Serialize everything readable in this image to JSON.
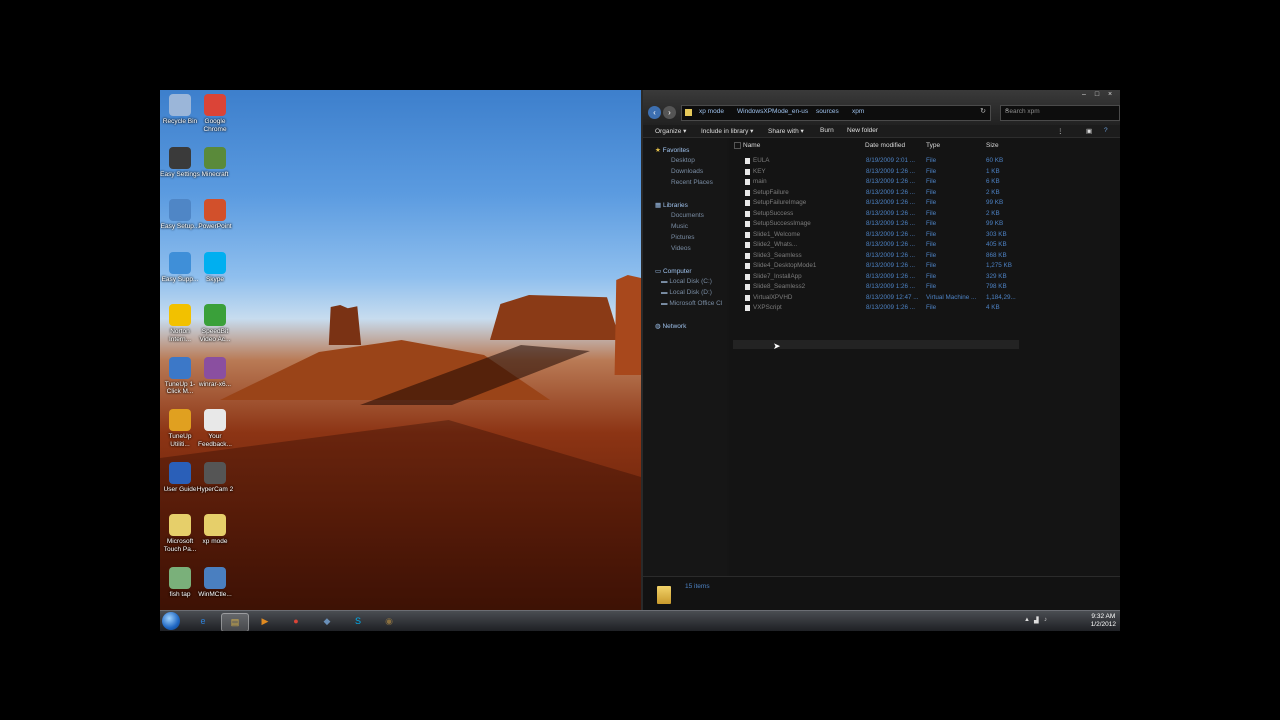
{
  "desktop_icons": [
    {
      "label": "Recycle Bin",
      "icon": "recycle-bin-icon",
      "color": "#9bb6d9"
    },
    {
      "label": "Google Chrome",
      "icon": "chrome-icon",
      "color": "#db4437"
    },
    {
      "label": "Easy Settings",
      "icon": "easy-settings-icon",
      "color": "#3a3a3a"
    },
    {
      "label": "Minecraft",
      "icon": "minecraft-icon",
      "color": "#5a8a3a"
    },
    {
      "label": "Easy Setup...",
      "icon": "easy-setup-icon",
      "color": "#4f86c6"
    },
    {
      "label": "PowerPoint",
      "icon": "powerpoint-icon",
      "color": "#d2502b"
    },
    {
      "label": "Easy Supp...",
      "icon": "easy-support-icon",
      "color": "#3f8fd8"
    },
    {
      "label": "Skype",
      "icon": "skype-icon",
      "color": "#00aff0"
    },
    {
      "label": "Norton Intern...",
      "icon": "norton-icon",
      "color": "#f2c100"
    },
    {
      "label": "SpeedBit Video Ac...",
      "icon": "speedbit-icon",
      "color": "#3aa03a"
    },
    {
      "label": "TuneUp 1-Click M...",
      "icon": "tuneup-icon",
      "color": "#3c78c8"
    },
    {
      "label": "winrar-x6...",
      "icon": "winrar-icon",
      "color": "#8a4fa0"
    },
    {
      "label": "TuneUp Utiliti...",
      "icon": "tuneup-utilities-icon",
      "color": "#e0a020"
    },
    {
      "label": "Your Feedback...",
      "icon": "feedback-icon",
      "color": "#e8e8e8"
    },
    {
      "label": "User Guide",
      "icon": "user-guide-icon",
      "color": "#2a5fb8"
    },
    {
      "label": "HyperCam 2",
      "icon": "hypercam-icon",
      "color": "#555555"
    },
    {
      "label": "Microsoft Touch Pa...",
      "icon": "touch-pack-icon",
      "color": "#e6cf6a"
    },
    {
      "label": "xp mode",
      "icon": "folder-icon",
      "color": "#e6cf6a"
    },
    {
      "label": "fish tap",
      "icon": "fish-tap-icon",
      "color": "#7ab07a"
    },
    {
      "label": "WinMCtle...",
      "icon": "winmctle-icon",
      "color": "#4a7fc0"
    }
  ],
  "explorer": {
    "window_controls": {
      "minimize": "–",
      "maximize": "□",
      "close": "×"
    },
    "breadcrumbs": [
      "xp mode",
      "WindowsXPMode_en-us",
      "sources",
      "xpm"
    ],
    "search_placeholder": "Search xpm",
    "toolbar": {
      "organize": "Organize ▾",
      "include": "Include in library ▾",
      "share": "Share with ▾",
      "burn": "Burn",
      "new_folder": "New folder"
    },
    "nav": {
      "favorites": "Favorites",
      "favorites_items": [
        "Desktop",
        "Downloads",
        "Recent Places"
      ],
      "libraries": "Libraries",
      "libraries_items": [
        "Documents",
        "Music",
        "Pictures",
        "Videos"
      ],
      "computer": "Computer",
      "computer_items": [
        "Local Disk (C:)",
        "Local Disk (D:)",
        "Microsoft Office Cl"
      ],
      "network": "Network"
    },
    "columns": [
      "Name",
      "Date modified",
      "Type",
      "Size"
    ],
    "files": [
      {
        "name": "EULA",
        "date": "8/19/2009 2:01 ...",
        "type": "File",
        "size": "60 KB"
      },
      {
        "name": "KEY",
        "date": "8/13/2009 1:26 ...",
        "type": "File",
        "size": "1 KB"
      },
      {
        "name": "main",
        "date": "8/13/2009 1:26 ...",
        "type": "File",
        "size": "6 KB"
      },
      {
        "name": "SetupFailure",
        "date": "8/13/2009 1:26 ...",
        "type": "File",
        "size": "2 KB"
      },
      {
        "name": "SetupFailureImage",
        "date": "8/13/2009 1:26 ...",
        "type": "File",
        "size": "99 KB"
      },
      {
        "name": "SetupSuccess",
        "date": "8/13/2009 1:26 ...",
        "type": "File",
        "size": "2 KB"
      },
      {
        "name": "SetupSuccessImage",
        "date": "8/13/2009 1:26 ...",
        "type": "File",
        "size": "99 KB"
      },
      {
        "name": "Slide1_Welcome",
        "date": "8/13/2009 1:26 ...",
        "type": "File",
        "size": "303 KB"
      },
      {
        "name": "Slide2_Whats...",
        "date": "8/13/2009 1:26 ...",
        "type": "File",
        "size": "405 KB"
      },
      {
        "name": "Slide3_Seamless",
        "date": "8/13/2009 1:26 ...",
        "type": "File",
        "size": "868 KB"
      },
      {
        "name": "Slide4_DesktopMode1",
        "date": "8/13/2009 1:26 ...",
        "type": "File",
        "size": "1,275 KB"
      },
      {
        "name": "Slide7_InstallApp",
        "date": "8/13/2009 1:26 ...",
        "type": "File",
        "size": "329 KB"
      },
      {
        "name": "Slide8_Seamless2",
        "date": "8/13/2009 1:26 ...",
        "type": "File",
        "size": "798 KB"
      },
      {
        "name": "VirtualXPVHD",
        "date": "8/13/2009 12:47 ...",
        "type": "Virtual Machine ...",
        "size": "1,184,29..."
      },
      {
        "name": "VXPScript",
        "date": "8/13/2009 1:26 ...",
        "type": "File",
        "size": "4 KB"
      }
    ],
    "status": "15 items"
  },
  "taskbar": {
    "apps": [
      {
        "icon": "ie-icon",
        "glyph": "e",
        "color": "#2d7fd6"
      },
      {
        "icon": "explorer-icon",
        "glyph": "▤",
        "color": "#d9b34a"
      },
      {
        "icon": "media-player-icon",
        "glyph": "▶",
        "color": "#e08a20"
      },
      {
        "icon": "chrome-icon",
        "glyph": "●",
        "color": "#db4437"
      },
      {
        "icon": "app-icon",
        "glyph": "◆",
        "color": "#6a8fb8"
      },
      {
        "icon": "skype-icon",
        "glyph": "S",
        "color": "#00aff0"
      },
      {
        "icon": "hypercam-icon",
        "glyph": "◉",
        "color": "#8a7040"
      }
    ],
    "time": "9:32 AM",
    "date": "1/2/2012"
  }
}
